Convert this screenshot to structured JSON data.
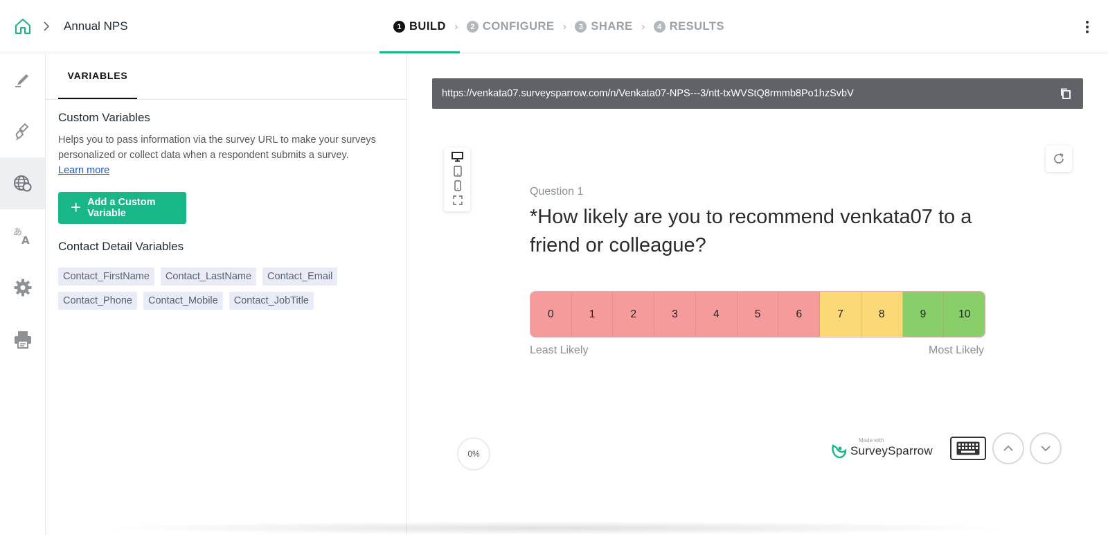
{
  "header": {
    "survey_name": "Annual NPS",
    "steps": [
      {
        "num": "1",
        "label": "BUILD",
        "active": true
      },
      {
        "num": "2",
        "label": "CONFIGURE",
        "active": false
      },
      {
        "num": "3",
        "label": "SHARE",
        "active": false
      },
      {
        "num": "4",
        "label": "RESULTS",
        "active": false
      }
    ]
  },
  "sidebar": {
    "items": [
      {
        "icon": "pencil-icon",
        "active": false
      },
      {
        "icon": "brush-icon",
        "active": false
      },
      {
        "icon": "globe-variables-icon",
        "active": true
      },
      {
        "icon": "translate-icon",
        "active": false
      },
      {
        "icon": "gear-icon",
        "active": false
      },
      {
        "icon": "printer-icon",
        "active": false
      }
    ]
  },
  "panel": {
    "tab": "VARIABLES",
    "custom_title": "Custom Variables",
    "custom_help": "Helps you to pass information via the survey URL to make your surveys personalized or collect data when a respondent submits a survey.",
    "learn_more": "Learn more",
    "add_button": "Add a Custom Variable",
    "contact_title": "Contact Detail Variables",
    "contact_variables": [
      "Contact_FirstName",
      "Contact_LastName",
      "Contact_Email",
      "Contact_Phone",
      "Contact_Mobile",
      "Contact_JobTitle"
    ]
  },
  "preview": {
    "url": "https://venkata07.surveysparrow.com/n/Venkata07-NPS---3/ntt-txWVStQ8rmmb8Po1hzSvbV",
    "question_label": "Question 1",
    "question_text": "*How likely are you to recommend venkata07 to a friend or colleague?",
    "scale": [
      "0",
      "1",
      "2",
      "3",
      "4",
      "5",
      "6",
      "7",
      "8",
      "9",
      "10"
    ],
    "low_label": "Least Likely",
    "high_label": "Most Likely",
    "progress": "0%",
    "brand_small": "Made with",
    "brand_name": "SurveySparrow"
  },
  "colors": {
    "accent": "#19b787",
    "detractor": "#f59b9b",
    "passive": "#fbd977",
    "promoter": "#88cf6a",
    "url_bar": "#5f6368"
  }
}
